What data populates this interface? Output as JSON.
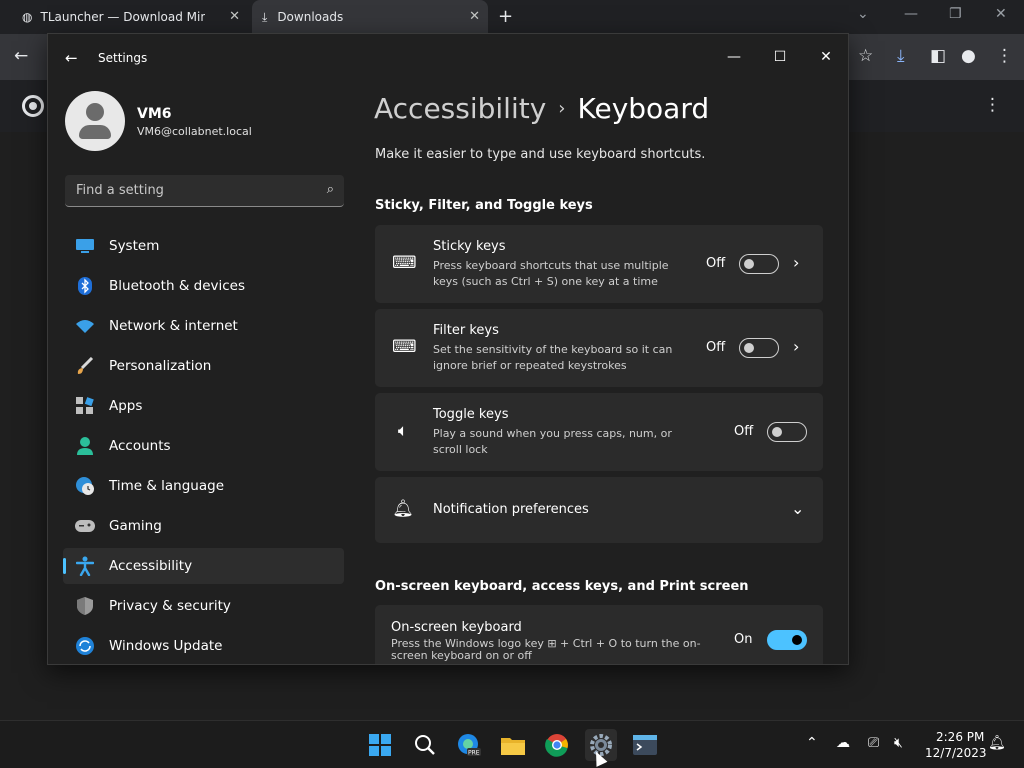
{
  "browser": {
    "tabs": [
      {
        "title": "TLauncher — Download Minecraft",
        "icon": "globe-icon"
      },
      {
        "title": "Downloads",
        "icon": "download-icon"
      }
    ]
  },
  "window": {
    "title": "Settings"
  },
  "profile": {
    "name": "VM6",
    "email": "VM6@collabnet.local"
  },
  "search": {
    "placeholder": "Find a setting"
  },
  "nav": {
    "items": [
      {
        "label": "System",
        "icon": "monitor-icon"
      },
      {
        "label": "Bluetooth & devices",
        "icon": "bluetooth-icon"
      },
      {
        "label": "Network & internet",
        "icon": "wifi-icon"
      },
      {
        "label": "Personalization",
        "icon": "brush-icon"
      },
      {
        "label": "Apps",
        "icon": "apps-icon"
      },
      {
        "label": "Accounts",
        "icon": "person-icon"
      },
      {
        "label": "Time & language",
        "icon": "globe-clock-icon"
      },
      {
        "label": "Gaming",
        "icon": "gamepad-icon"
      },
      {
        "label": "Accessibility",
        "icon": "accessibility-icon"
      },
      {
        "label": "Privacy & security",
        "icon": "shield-icon"
      },
      {
        "label": "Windows Update",
        "icon": "update-icon"
      }
    ],
    "active": "Accessibility"
  },
  "page": {
    "breadcrumb_parent": "Accessibility",
    "breadcrumb_sep": "›",
    "title": "Keyboard",
    "subtitle": "Make it easier to type and use keyboard shortcuts.",
    "section1": "Sticky, Filter, and Toggle keys",
    "section2": "On-screen keyboard, access keys, and Print screen",
    "cards": [
      {
        "title": "Sticky keys",
        "desc": "Press keyboard shortcuts that use multiple keys (such as Ctrl + S) one key at a time",
        "state": "Off",
        "on": false,
        "icon": "sticky-keys-icon"
      },
      {
        "title": "Filter keys",
        "desc": "Set the sensitivity of the keyboard so it can ignore brief or repeated keystrokes",
        "state": "Off",
        "on": false,
        "icon": "filter-keys-icon"
      },
      {
        "title": "Toggle keys",
        "desc": "Play a sound when you press caps, num, or scroll lock",
        "state": "Off",
        "on": false,
        "icon": "speaker-icon"
      },
      {
        "title": "Notification preferences",
        "icon": "bell-icon"
      },
      {
        "title": "On-screen keyboard",
        "desc": "Press the Windows logo key ⊞ + Ctrl + O to turn the on-screen keyboard on or off",
        "state": "On",
        "on": true
      }
    ]
  },
  "taskbar": {
    "apps": [
      "windows-start-icon",
      "search-icon",
      "edge-pre-icon",
      "file-explorer-icon",
      "chrome-icon",
      "settings-icon",
      "terminal-icon"
    ],
    "time": "2:26 PM",
    "date": "12/7/2023"
  },
  "colors": {
    "accent": "#4cc2ff",
    "background": "#202020",
    "card": "#2b2b2b"
  }
}
